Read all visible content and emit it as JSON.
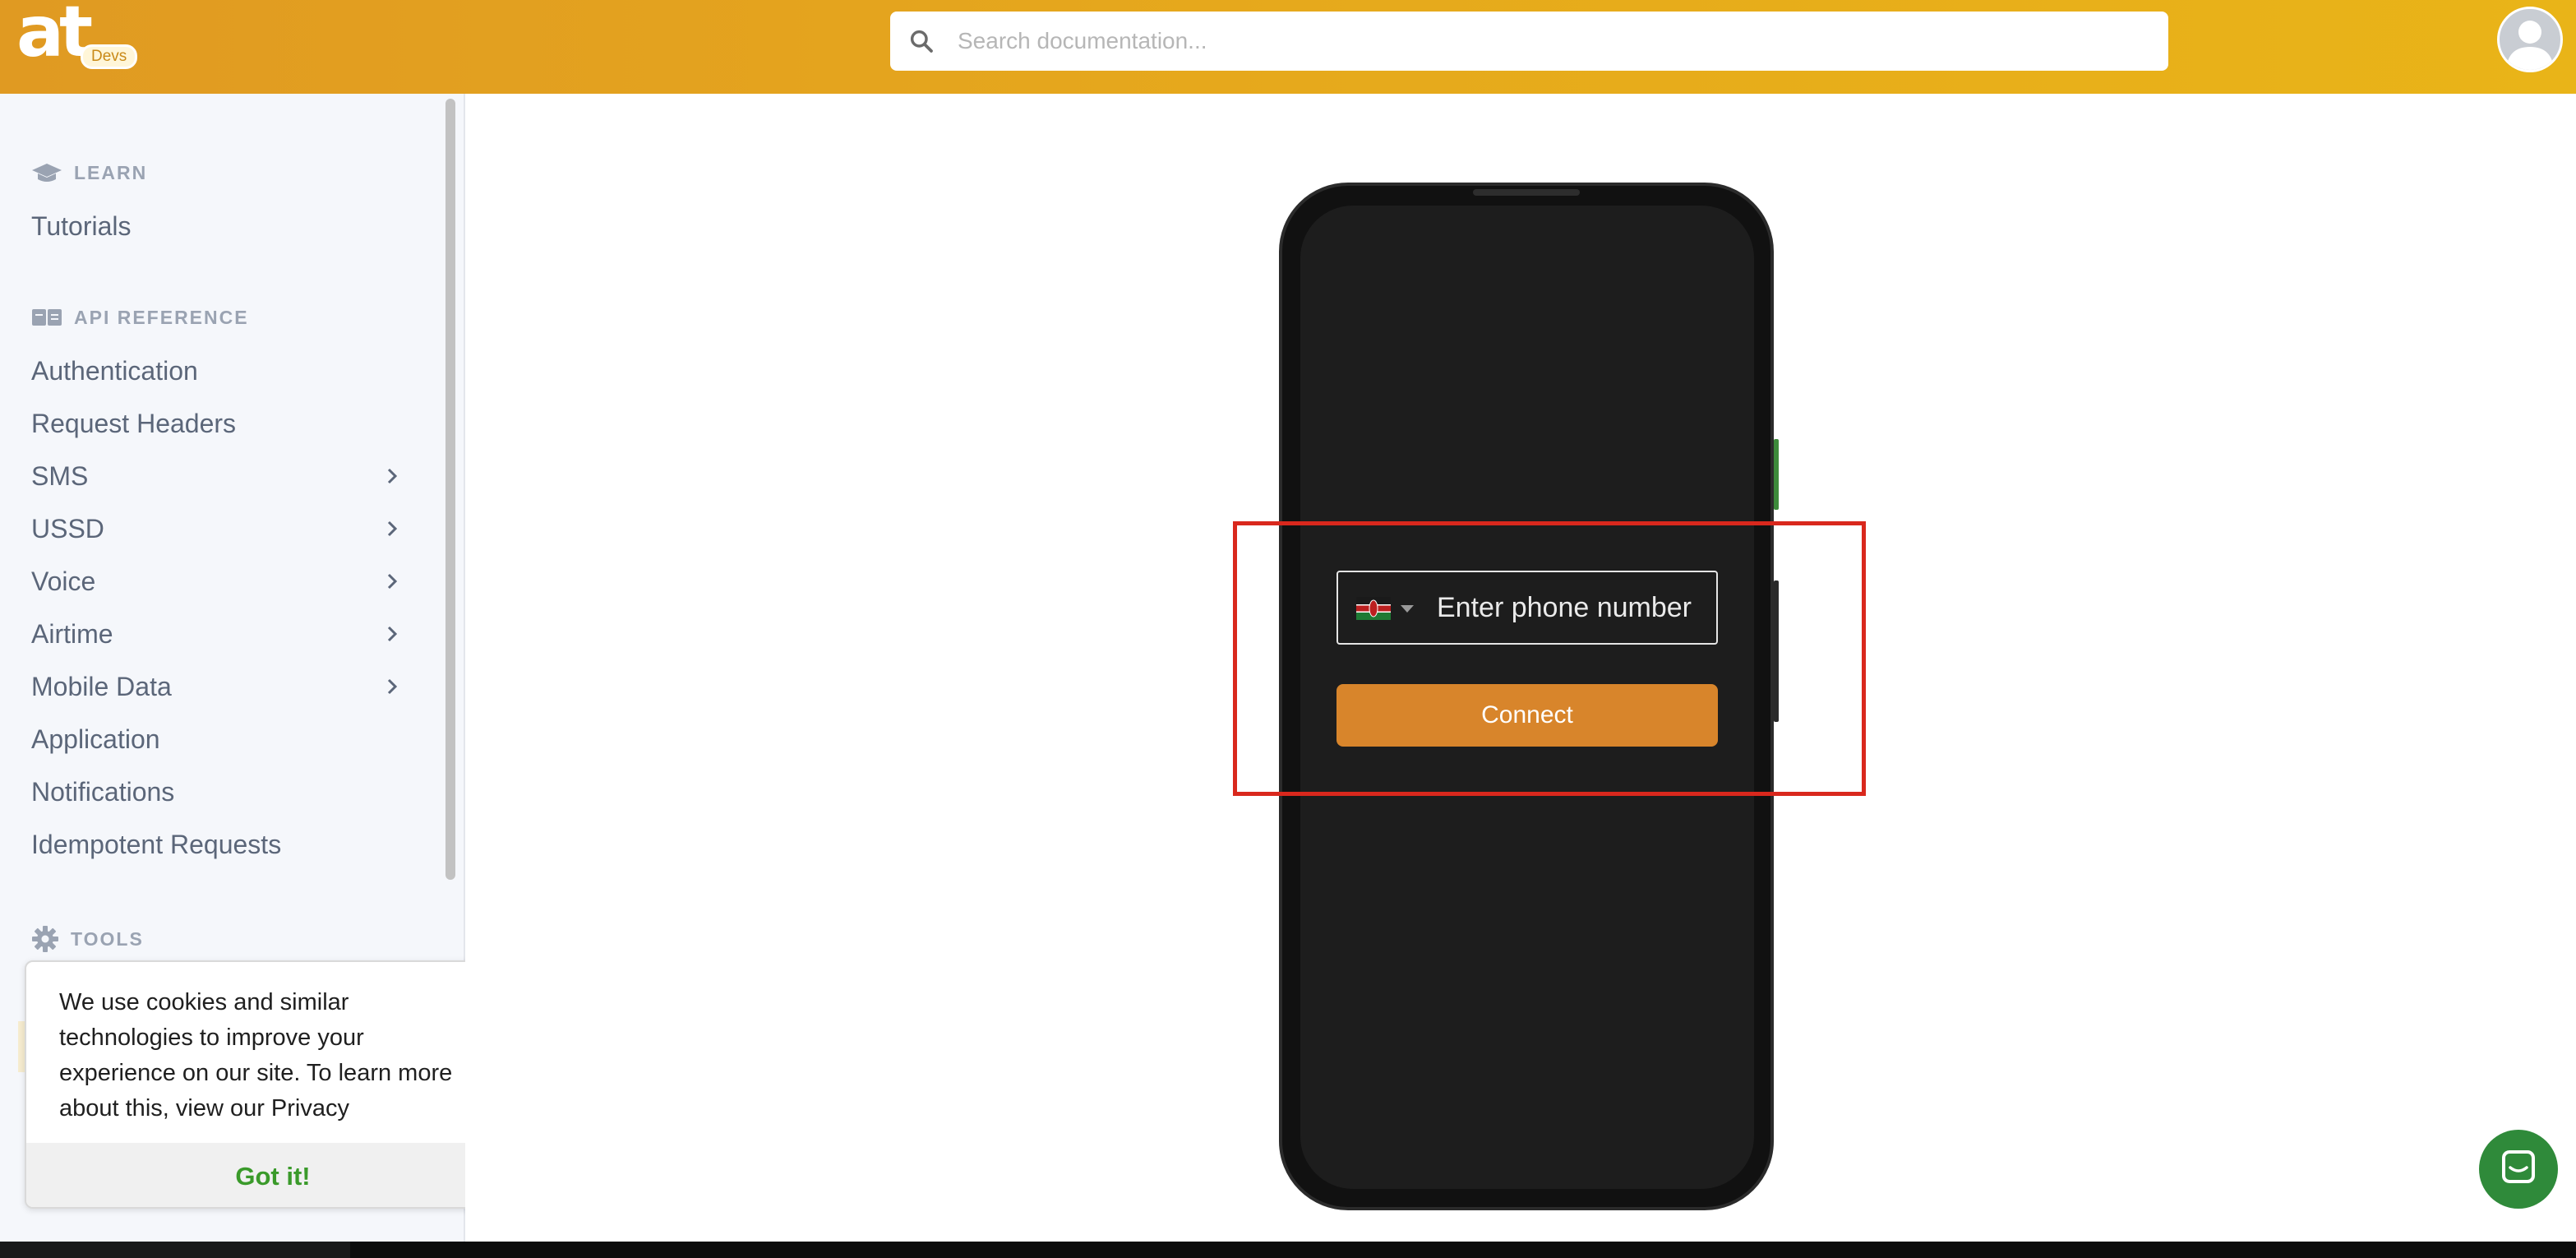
{
  "header": {
    "logo_text": "at",
    "logo_badge": "Devs",
    "search_placeholder": "Search documentation..."
  },
  "sidebar": {
    "sections": [
      {
        "title": "LEARN",
        "icon": "graduation-cap-icon"
      },
      {
        "title": "API REFERENCE",
        "icon": "book-icon"
      },
      {
        "title": "TOOLS",
        "icon": "gear-icon"
      }
    ],
    "learn_items": [
      {
        "label": "Tutorials"
      }
    ],
    "api_items": [
      {
        "label": "Authentication",
        "expandable": false
      },
      {
        "label": "Request Headers",
        "expandable": false
      },
      {
        "label": "SMS",
        "expandable": true
      },
      {
        "label": "USSD",
        "expandable": true
      },
      {
        "label": "Voice",
        "expandable": true
      },
      {
        "label": "Airtime",
        "expandable": true
      },
      {
        "label": "Mobile Data",
        "expandable": true
      },
      {
        "label": "Application",
        "expandable": false
      },
      {
        "label": "Notifications",
        "expandable": false
      },
      {
        "label": "Idempotent Requests",
        "expandable": false
      }
    ]
  },
  "cookie_banner": {
    "text": "We use cookies and similar technologies to improve your experience on our site. To learn more about this, view our Privacy",
    "button": "Got it!"
  },
  "simulator": {
    "phone_placeholder": "Enter phone number",
    "connect_label": "Connect",
    "country_flag": "kenya-flag-icon"
  },
  "colors": {
    "header_start": "#e09a22",
    "header_end": "#e9b418",
    "connect_button": "#d8852b",
    "highlight_box": "#d9281d",
    "accept_text": "#3a9a2a",
    "chat_button": "#2f8a3a"
  }
}
